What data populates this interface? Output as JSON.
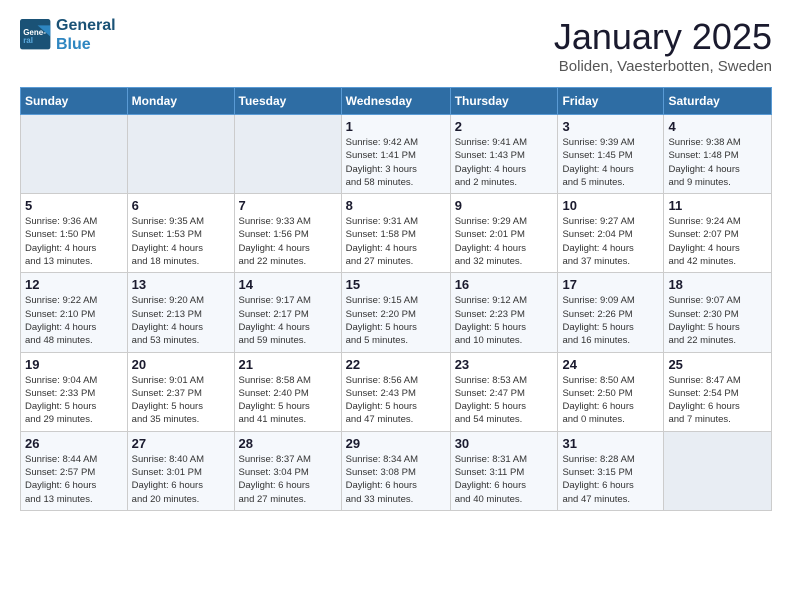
{
  "header": {
    "logo_line1": "General",
    "logo_line2": "Blue",
    "title": "January 2025",
    "subtitle": "Boliden, Vaesterbotten, Sweden"
  },
  "weekdays": [
    "Sunday",
    "Monday",
    "Tuesday",
    "Wednesday",
    "Thursday",
    "Friday",
    "Saturday"
  ],
  "weeks": [
    [
      {
        "day": "",
        "info": ""
      },
      {
        "day": "",
        "info": ""
      },
      {
        "day": "",
        "info": ""
      },
      {
        "day": "1",
        "info": "Sunrise: 9:42 AM\nSunset: 1:41 PM\nDaylight: 3 hours\nand 58 minutes."
      },
      {
        "day": "2",
        "info": "Sunrise: 9:41 AM\nSunset: 1:43 PM\nDaylight: 4 hours\nand 2 minutes."
      },
      {
        "day": "3",
        "info": "Sunrise: 9:39 AM\nSunset: 1:45 PM\nDaylight: 4 hours\nand 5 minutes."
      },
      {
        "day": "4",
        "info": "Sunrise: 9:38 AM\nSunset: 1:48 PM\nDaylight: 4 hours\nand 9 minutes."
      }
    ],
    [
      {
        "day": "5",
        "info": "Sunrise: 9:36 AM\nSunset: 1:50 PM\nDaylight: 4 hours\nand 13 minutes."
      },
      {
        "day": "6",
        "info": "Sunrise: 9:35 AM\nSunset: 1:53 PM\nDaylight: 4 hours\nand 18 minutes."
      },
      {
        "day": "7",
        "info": "Sunrise: 9:33 AM\nSunset: 1:56 PM\nDaylight: 4 hours\nand 22 minutes."
      },
      {
        "day": "8",
        "info": "Sunrise: 9:31 AM\nSunset: 1:58 PM\nDaylight: 4 hours\nand 27 minutes."
      },
      {
        "day": "9",
        "info": "Sunrise: 9:29 AM\nSunset: 2:01 PM\nDaylight: 4 hours\nand 32 minutes."
      },
      {
        "day": "10",
        "info": "Sunrise: 9:27 AM\nSunset: 2:04 PM\nDaylight: 4 hours\nand 37 minutes."
      },
      {
        "day": "11",
        "info": "Sunrise: 9:24 AM\nSunset: 2:07 PM\nDaylight: 4 hours\nand 42 minutes."
      }
    ],
    [
      {
        "day": "12",
        "info": "Sunrise: 9:22 AM\nSunset: 2:10 PM\nDaylight: 4 hours\nand 48 minutes."
      },
      {
        "day": "13",
        "info": "Sunrise: 9:20 AM\nSunset: 2:13 PM\nDaylight: 4 hours\nand 53 minutes."
      },
      {
        "day": "14",
        "info": "Sunrise: 9:17 AM\nSunset: 2:17 PM\nDaylight: 4 hours\nand 59 minutes."
      },
      {
        "day": "15",
        "info": "Sunrise: 9:15 AM\nSunset: 2:20 PM\nDaylight: 5 hours\nand 5 minutes."
      },
      {
        "day": "16",
        "info": "Sunrise: 9:12 AM\nSunset: 2:23 PM\nDaylight: 5 hours\nand 10 minutes."
      },
      {
        "day": "17",
        "info": "Sunrise: 9:09 AM\nSunset: 2:26 PM\nDaylight: 5 hours\nand 16 minutes."
      },
      {
        "day": "18",
        "info": "Sunrise: 9:07 AM\nSunset: 2:30 PM\nDaylight: 5 hours\nand 22 minutes."
      }
    ],
    [
      {
        "day": "19",
        "info": "Sunrise: 9:04 AM\nSunset: 2:33 PM\nDaylight: 5 hours\nand 29 minutes."
      },
      {
        "day": "20",
        "info": "Sunrise: 9:01 AM\nSunset: 2:37 PM\nDaylight: 5 hours\nand 35 minutes."
      },
      {
        "day": "21",
        "info": "Sunrise: 8:58 AM\nSunset: 2:40 PM\nDaylight: 5 hours\nand 41 minutes."
      },
      {
        "day": "22",
        "info": "Sunrise: 8:56 AM\nSunset: 2:43 PM\nDaylight: 5 hours\nand 47 minutes."
      },
      {
        "day": "23",
        "info": "Sunrise: 8:53 AM\nSunset: 2:47 PM\nDaylight: 5 hours\nand 54 minutes."
      },
      {
        "day": "24",
        "info": "Sunrise: 8:50 AM\nSunset: 2:50 PM\nDaylight: 6 hours\nand 0 minutes."
      },
      {
        "day": "25",
        "info": "Sunrise: 8:47 AM\nSunset: 2:54 PM\nDaylight: 6 hours\nand 7 minutes."
      }
    ],
    [
      {
        "day": "26",
        "info": "Sunrise: 8:44 AM\nSunset: 2:57 PM\nDaylight: 6 hours\nand 13 minutes."
      },
      {
        "day": "27",
        "info": "Sunrise: 8:40 AM\nSunset: 3:01 PM\nDaylight: 6 hours\nand 20 minutes."
      },
      {
        "day": "28",
        "info": "Sunrise: 8:37 AM\nSunset: 3:04 PM\nDaylight: 6 hours\nand 27 minutes."
      },
      {
        "day": "29",
        "info": "Sunrise: 8:34 AM\nSunset: 3:08 PM\nDaylight: 6 hours\nand 33 minutes."
      },
      {
        "day": "30",
        "info": "Sunrise: 8:31 AM\nSunset: 3:11 PM\nDaylight: 6 hours\nand 40 minutes."
      },
      {
        "day": "31",
        "info": "Sunrise: 8:28 AM\nSunset: 3:15 PM\nDaylight: 6 hours\nand 47 minutes."
      },
      {
        "day": "",
        "info": ""
      }
    ]
  ]
}
